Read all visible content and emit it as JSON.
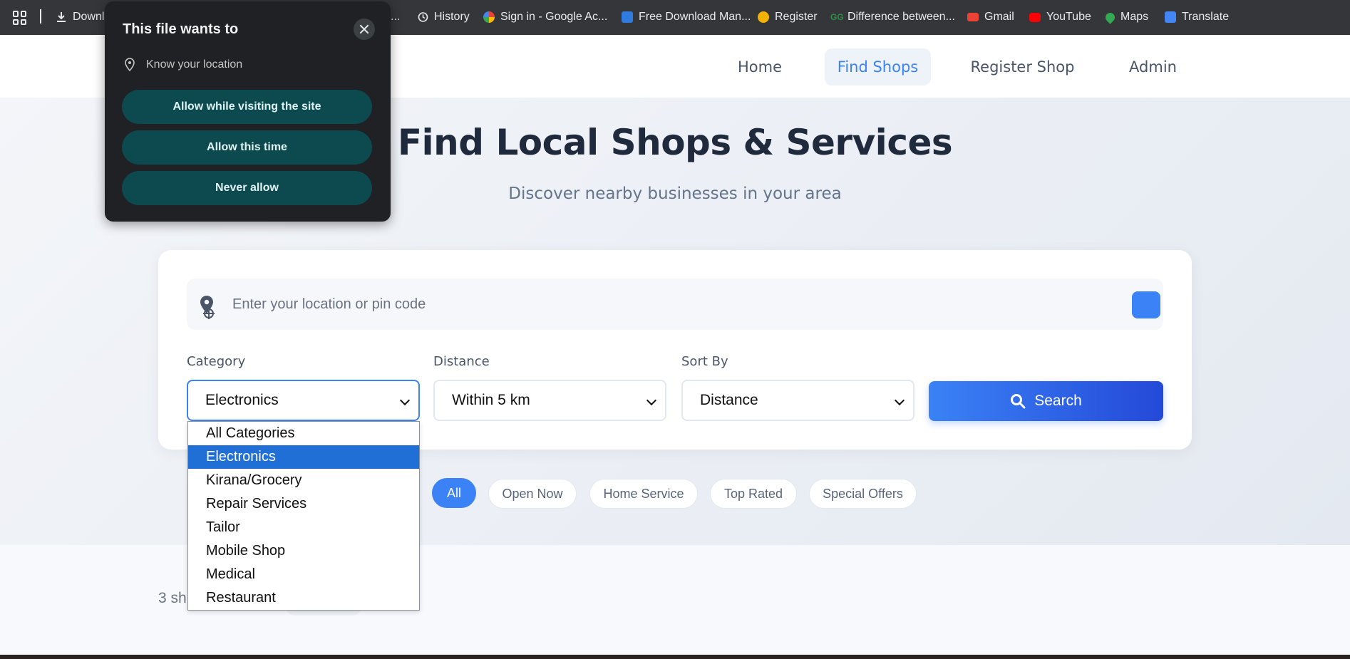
{
  "bookmarks": {
    "items": [
      {
        "label": "Downl",
        "icon": "download-icon"
      },
      {
        "label": "...",
        "icon": ""
      },
      {
        "label": "History",
        "icon": "history-icon"
      },
      {
        "label": "Sign in - Google Ac...",
        "icon": "google-icon"
      },
      {
        "label": "Free Download Man...",
        "icon": "fdm-icon"
      },
      {
        "label": "Register",
        "icon": "register-icon"
      },
      {
        "label": "Difference between...",
        "icon": "gfg-icon"
      },
      {
        "label": "Gmail",
        "icon": "gmail-icon"
      },
      {
        "label": "YouTube",
        "icon": "youtube-icon"
      },
      {
        "label": "Maps",
        "icon": "maps-icon"
      },
      {
        "label": "Translate",
        "icon": "translate-icon"
      }
    ]
  },
  "nav": {
    "items": [
      {
        "label": "Home"
      },
      {
        "label": "Find Shops"
      },
      {
        "label": "Register Shop"
      },
      {
        "label": "Admin"
      }
    ]
  },
  "hero": {
    "title": "Find Local Shops & Services",
    "subtitle": "Discover nearby businesses in your area"
  },
  "search": {
    "location_placeholder": "Enter your location or pin code",
    "location_value": "",
    "category_label": "Category",
    "category_value": "Electronics",
    "distance_label": "Distance",
    "distance_value": "Within 5 km",
    "sort_label": "Sort By",
    "sort_value": "Distance",
    "button_label": "Search"
  },
  "filters": {
    "chips": [
      {
        "label": "All",
        "active": true
      },
      {
        "label": "Open Now"
      },
      {
        "label": "Home Service"
      },
      {
        "label": "Top Rated"
      },
      {
        "label": "Special Offers"
      }
    ]
  },
  "results": {
    "count_text": "3 sh"
  },
  "category_dropdown": {
    "options": [
      "All Categories",
      "Electronics",
      "Kirana/Grocery",
      "Repair Services",
      "Tailor",
      "Mobile Shop",
      "Medical",
      "Restaurant"
    ],
    "selected": "Electronics"
  },
  "permission_popup": {
    "title": "This file wants to",
    "request": "Know your location",
    "buttons": {
      "allow_visiting": "Allow while visiting the site",
      "allow_once": "Allow this time",
      "never": "Never allow"
    }
  },
  "colors": {
    "accent": "#3b82f6",
    "popup_bg": "#202124",
    "popup_button": "#0c4a4f",
    "dropdown_selected": "#1f6fd6"
  }
}
